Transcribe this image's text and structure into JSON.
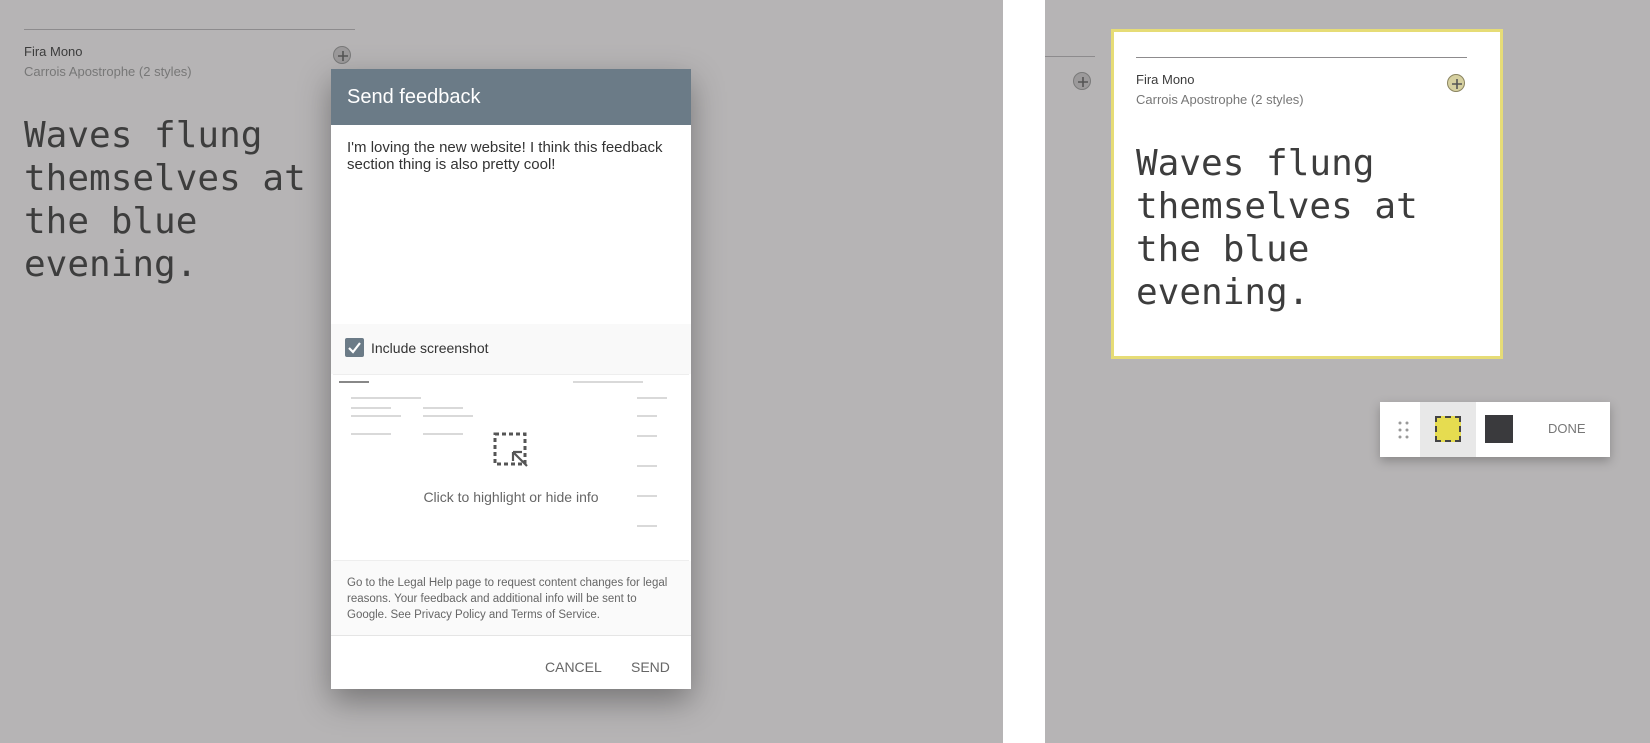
{
  "left": {
    "font_name": "Fira Mono",
    "font_meta": "Carrois Apostrophe (2 styles)",
    "specimen": "Waves flung\nthemselves at\nthe blue\nevening."
  },
  "dialog": {
    "title": "Send feedback",
    "feedback_text": "I'm loving the new website! I think this feedback section thing is also pretty cool!",
    "include_label": "Include screenshot",
    "highlight_text": "Click to highlight or hide info",
    "legal": {
      "before": "Go to the Legal Help page to request content changes for legal reasons. Your feedback and additional info will be sent to Google. See ",
      "privacy": "Privacy Policy",
      "and": " and ",
      "terms": "Terms of Service",
      "after": "."
    },
    "cancel_label": "CANCEL",
    "send_label": "SEND"
  },
  "right": {
    "font_name": "Fira Mono",
    "font_meta": "Carrois Apostrophe (2 styles)",
    "specimen": "Waves flung\nthemselves at\nthe blue\nevening.",
    "done_label": "DONE"
  },
  "colors": {
    "header": "#6b7b87",
    "overlay": "#b6b4b5",
    "highlight": "#e6dc50"
  }
}
